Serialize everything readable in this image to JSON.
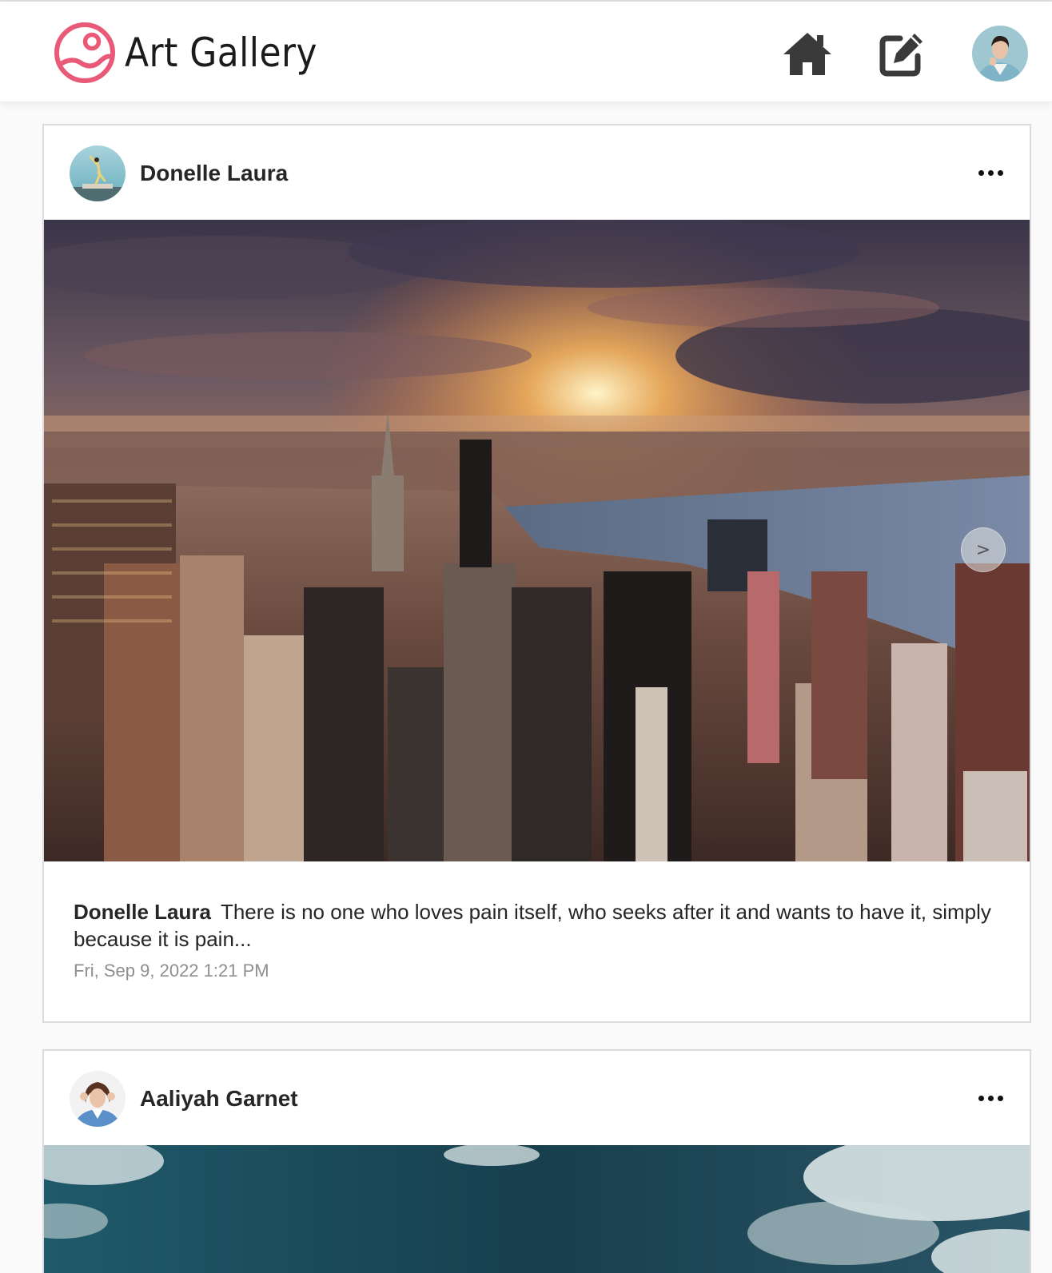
{
  "app": {
    "title": "Art Gallery",
    "accent_color": "#e95a78",
    "icons": [
      "photo-portrait-logo-icon",
      "home-icon",
      "edit-icon"
    ]
  },
  "posts": [
    {
      "author": "Donelle Laura",
      "caption_author": "Donelle Laura",
      "caption": "There is no one who loves pain itself, who seeks after it and wants to have it, simply because it is pain...",
      "timestamp": "Fri, Sep 9, 2022 1:21 PM",
      "carousel_next_label": ">"
    },
    {
      "author": "Aaliyah Garnet"
    }
  ]
}
